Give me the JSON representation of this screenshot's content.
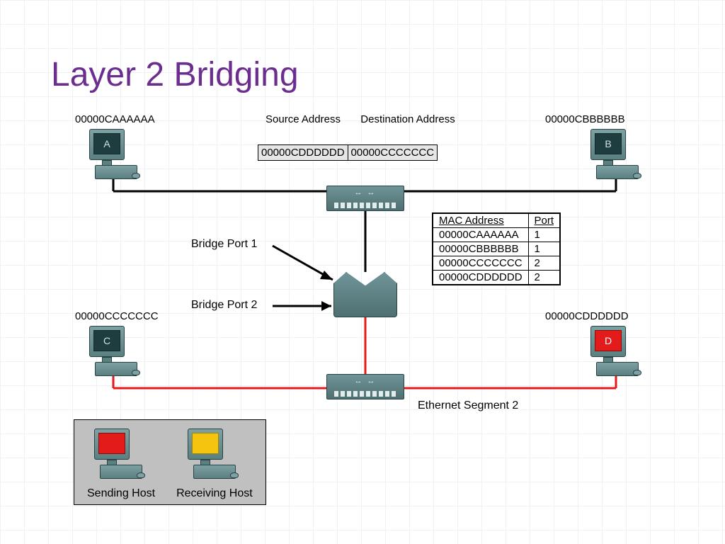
{
  "title": "Layer 2 Bridging",
  "hosts": {
    "A": {
      "mac": "00000CAAAAAA",
      "letter": "A"
    },
    "B": {
      "mac": "00000CBBBBBB",
      "letter": "B"
    },
    "C": {
      "mac": "00000CCCCCCC",
      "letter": "C"
    },
    "D": {
      "mac": "00000CDDDDDD",
      "letter": "D"
    }
  },
  "frame": {
    "source_caption": "Source\nAddress",
    "dest_caption": "Destination\nAddress",
    "source": "00000CDDDDDD",
    "dest": "00000CCCCCCC"
  },
  "bridge_ports": {
    "p1": "Bridge Port 1",
    "p2": "Bridge Port 2"
  },
  "mac_table": {
    "headers": {
      "mac": "MAC Address",
      "port": "Port"
    },
    "rows": [
      {
        "mac": "00000CAAAAAA",
        "port": "1"
      },
      {
        "mac": "00000CBBBBBB",
        "port": "1"
      },
      {
        "mac": "00000CCCCCCC",
        "port": "2"
      },
      {
        "mac": "00000CDDDDDD",
        "port": "2"
      }
    ]
  },
  "segment_label": "Ethernet Segment 2",
  "legend": {
    "sending": "Sending Host",
    "receiving": "Receiving Host"
  }
}
